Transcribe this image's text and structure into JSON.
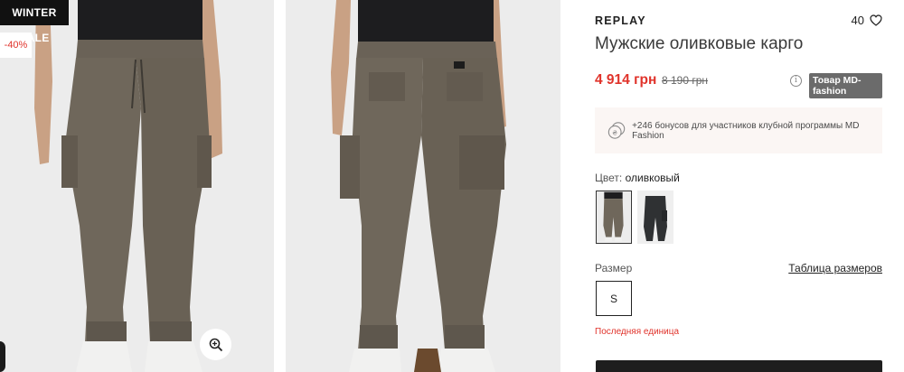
{
  "badges": {
    "sale": "WINTER SALE",
    "discount": "-40%"
  },
  "gallery": {
    "zoom_icon": "zoom-in-icon",
    "pants_color": "#6f675b",
    "background_color": "#ececec"
  },
  "product": {
    "brand": "REPLAY",
    "favorites_count": "40",
    "title": "Мужские оливковые карго",
    "price_current": "4 914 грн",
    "price_old": "8 190 грн",
    "seller_badge": "Товар MD-fashion",
    "bonus_text": "+246 бонусов для участников клубной программы MD Fashion",
    "color_label": "Цвет:",
    "color_value": "оливковый",
    "size_label": "Размер",
    "size_table_link": "Таблица размеров",
    "sizes": [
      "S"
    ],
    "stock_note": "Последняя единица"
  },
  "colors": {
    "accent_red": "#e0332b",
    "dark": "#1e1e1e",
    "bonus_bg": "#fbf6f4"
  }
}
